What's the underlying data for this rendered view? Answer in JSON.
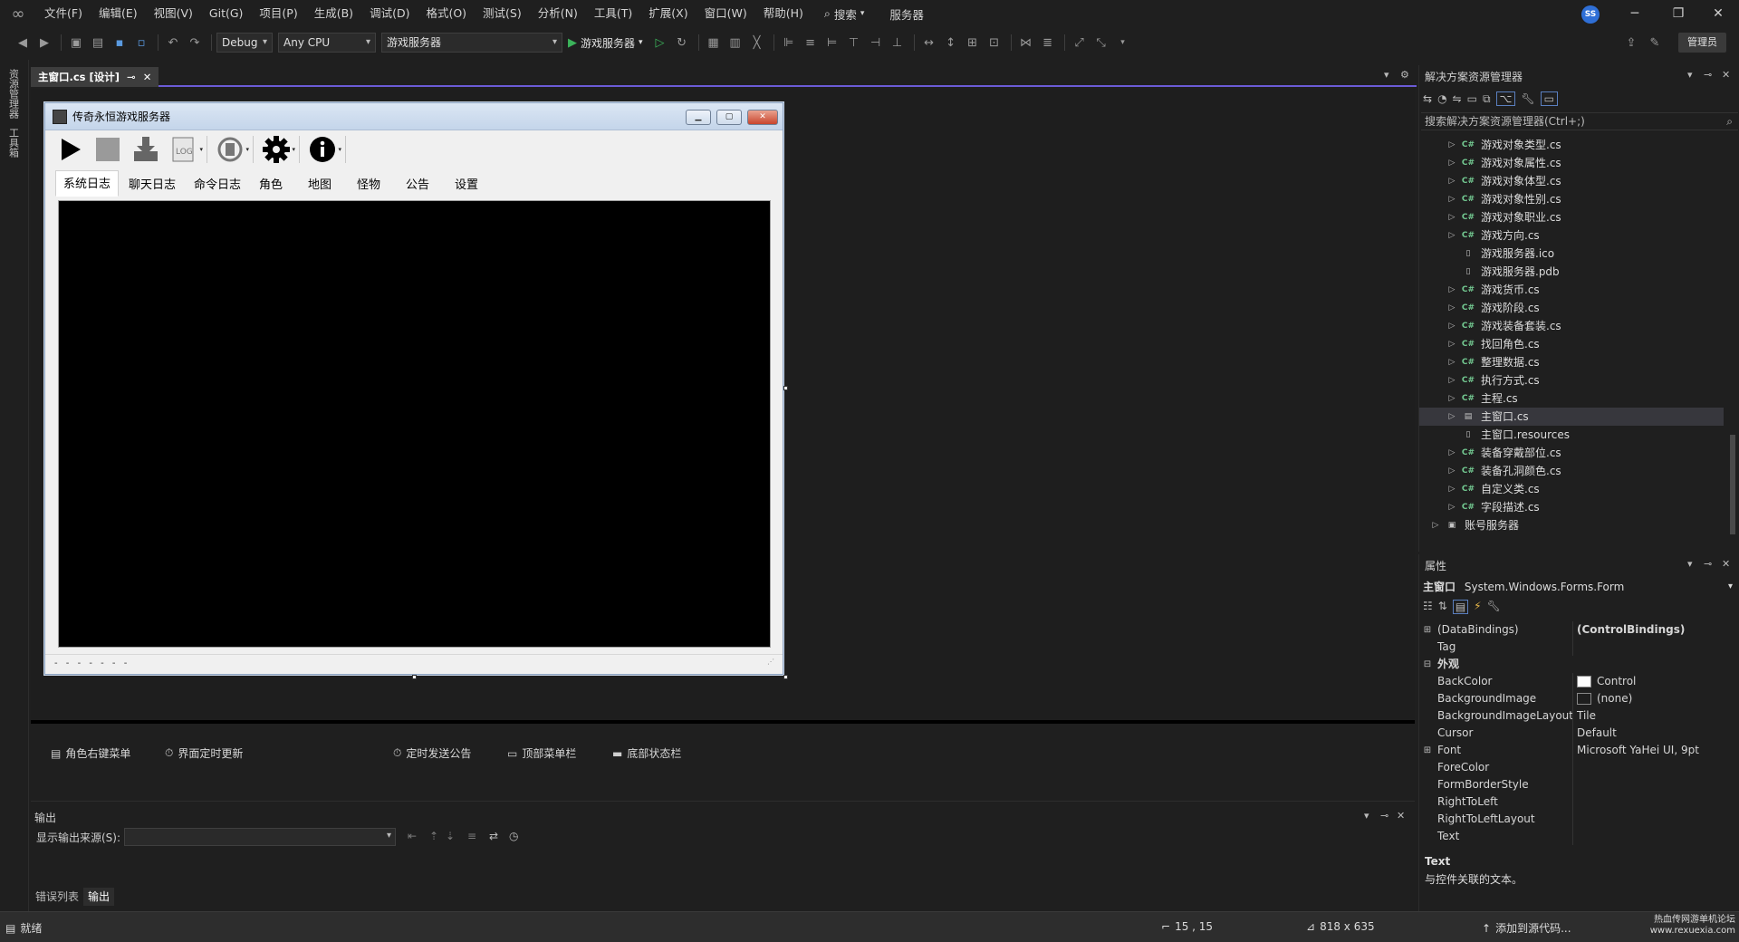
{
  "menubar": {
    "items": [
      "文件(F)",
      "编辑(E)",
      "视图(V)",
      "Git(G)",
      "项目(P)",
      "生成(B)",
      "调试(D)",
      "格式(O)",
      "测试(S)",
      "分析(N)",
      "工具(T)",
      "扩展(X)",
      "窗口(W)",
      "帮助(H)"
    ],
    "search_label": "搜索",
    "server_label": "服务器",
    "avatar_initials": "SS"
  },
  "toolbar": {
    "config": "Debug",
    "platform": "Any CPU",
    "project": "游戏服务器",
    "start_label": "游戏服务器",
    "admin_label": "管理员"
  },
  "left_strip": {
    "tab1": "资源管理器",
    "tab2": "工具箱"
  },
  "document_tab": {
    "label": "主窗口.cs [设计]"
  },
  "form": {
    "title": "传奇永恒游戏服务器",
    "toolbar_icons": [
      "play-icon",
      "stop-icon",
      "save-download-icon",
      "log-icon",
      "backup-icon",
      "settings-gear-icon",
      "info-icon"
    ],
    "tabs": [
      "系统日志",
      "聊天日志",
      "命令日志",
      "角色",
      "地图",
      "怪物",
      "公告",
      "设置"
    ],
    "active_tab": "系统日志",
    "status_text": "- - - - - - -"
  },
  "tray": {
    "items": [
      "角色右键菜单",
      "界面定时更新",
      "定时发送公告",
      "顶部菜单栏",
      "底部状态栏"
    ]
  },
  "output_panel": {
    "title": "输出",
    "source_label": "显示输出来源(S):",
    "tabs": [
      "错误列表",
      "输出"
    ],
    "active_tab": "输出"
  },
  "solution_explorer": {
    "title": "解决方案资源管理器",
    "search_placeholder": "搜索解决方案资源管理器(Ctrl+;)",
    "items": [
      {
        "label": "游戏对象类型.cs",
        "type": "cs",
        "expandable": true
      },
      {
        "label": "游戏对象属性.cs",
        "type": "cs",
        "expandable": true
      },
      {
        "label": "游戏对象体型.cs",
        "type": "cs",
        "expandable": true
      },
      {
        "label": "游戏对象性别.cs",
        "type": "cs",
        "expandable": true
      },
      {
        "label": "游戏对象职业.cs",
        "type": "cs",
        "expandable": true
      },
      {
        "label": "游戏方向.cs",
        "type": "cs",
        "expandable": true
      },
      {
        "label": "游戏服务器.ico",
        "type": "file",
        "expandable": false
      },
      {
        "label": "游戏服务器.pdb",
        "type": "file",
        "expandable": false
      },
      {
        "label": "游戏货币.cs",
        "type": "cs",
        "expandable": true
      },
      {
        "label": "游戏阶段.cs",
        "type": "cs",
        "expandable": true
      },
      {
        "label": "游戏装备套装.cs",
        "type": "cs",
        "expandable": true
      },
      {
        "label": "找回角色.cs",
        "type": "cs",
        "expandable": true
      },
      {
        "label": "整理数据.cs",
        "type": "cs",
        "expandable": true
      },
      {
        "label": "执行方式.cs",
        "type": "cs",
        "expandable": true
      },
      {
        "label": "主程.cs",
        "type": "cs",
        "expandable": true
      },
      {
        "label": "主窗口.cs",
        "type": "form",
        "expandable": true,
        "selected": true
      },
      {
        "label": "主窗口.resources",
        "type": "file",
        "expandable": false
      },
      {
        "label": "装备穿戴部位.cs",
        "type": "cs",
        "expandable": true
      },
      {
        "label": "装备孔洞颜色.cs",
        "type": "cs",
        "expandable": true
      },
      {
        "label": "自定义类.cs",
        "type": "cs",
        "expandable": true
      },
      {
        "label": "字段描述.cs",
        "type": "cs",
        "expandable": true
      }
    ],
    "root_item": "账号服务器"
  },
  "properties": {
    "title": "属性",
    "object_name": "主窗口",
    "object_type": "System.Windows.Forms.Form",
    "rows": [
      {
        "name": "(DataBindings)",
        "value": "(ControlBindings)",
        "expander": "⊞",
        "bold_value": true
      },
      {
        "name": "Tag",
        "value": "",
        "expander": ""
      },
      {
        "name": "外观",
        "value": "",
        "expander": "⊟",
        "category": true
      },
      {
        "name": "BackColor",
        "value": "Control",
        "expander": "",
        "swatch": "#ffffff"
      },
      {
        "name": "BackgroundImage",
        "value": "(none)",
        "expander": "",
        "swatch": "#1e1e1e"
      },
      {
        "name": "BackgroundImageLayout",
        "value": "Tile",
        "expander": ""
      },
      {
        "name": "Cursor",
        "value": "Default",
        "expander": ""
      },
      {
        "name": "Font",
        "value": "Microsoft YaHei UI, 9pt",
        "expander": "⊞"
      },
      {
        "name": "ForeColor",
        "value": "",
        "expander": ""
      },
      {
        "name": "FormBorderStyle",
        "value": "",
        "expander": ""
      },
      {
        "name": "RightToLeft",
        "value": "",
        "expander": ""
      },
      {
        "name": "RightToLeftLayout",
        "value": "",
        "expander": ""
      },
      {
        "name": "Text",
        "value": "",
        "expander": ""
      }
    ],
    "desc_title": "Text",
    "desc_text": "与控件关联的文本。"
  },
  "statusbar": {
    "ready": "就绪",
    "position": "15 , 15",
    "size": "818 x 635",
    "source_control": "添加到源代码...",
    "watermark": "热血传网游单机论坛 www.rexuexia.com"
  },
  "colors": {
    "accent": "#6b5bd6",
    "cs_icon": "#73c991",
    "play_green": "#3bb35a"
  }
}
